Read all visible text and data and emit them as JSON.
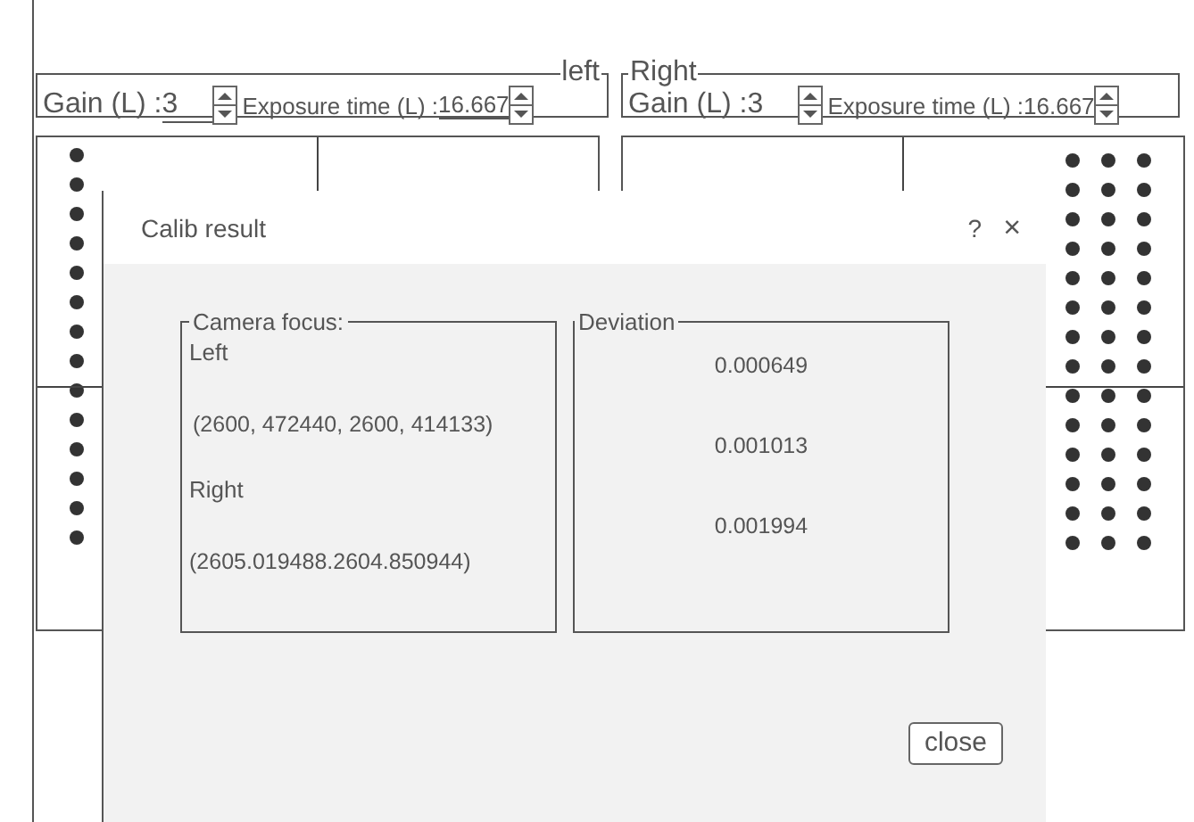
{
  "cameras": [
    {
      "title": "left",
      "title_at_right": true,
      "gain_label": "Gain (L) :",
      "gain_value": "3",
      "gain_underlined": true,
      "exposure_label": "Exposure time (L) : ",
      "exposure_value": "16.667",
      "exposure_underlined": true
    },
    {
      "title": "Right",
      "title_at_right": false,
      "gain_label": "Gain (L) :",
      "gain_value": "3",
      "gain_underlined": false,
      "exposure_label": "Exposure time (L) : ",
      "exposure_value": "16.667",
      "exposure_underlined": false
    }
  ],
  "dialog": {
    "title": "Calib result",
    "help": "?",
    "close_glyph": "×",
    "focus_group": {
      "title": "Camera focus:",
      "lines": [
        {
          "kind": "label",
          "text": "Left"
        },
        {
          "kind": "value",
          "text": "(2600, 472440, 2600, 414133)"
        },
        {
          "kind": "label",
          "text": "Right"
        },
        {
          "kind": "value",
          "text": "(2605.019488.2604.850944)"
        }
      ]
    },
    "deviation_group": {
      "title": "Deviation",
      "values": [
        "0.000649",
        "0.001013",
        "0.001994"
      ]
    },
    "button": "close"
  }
}
